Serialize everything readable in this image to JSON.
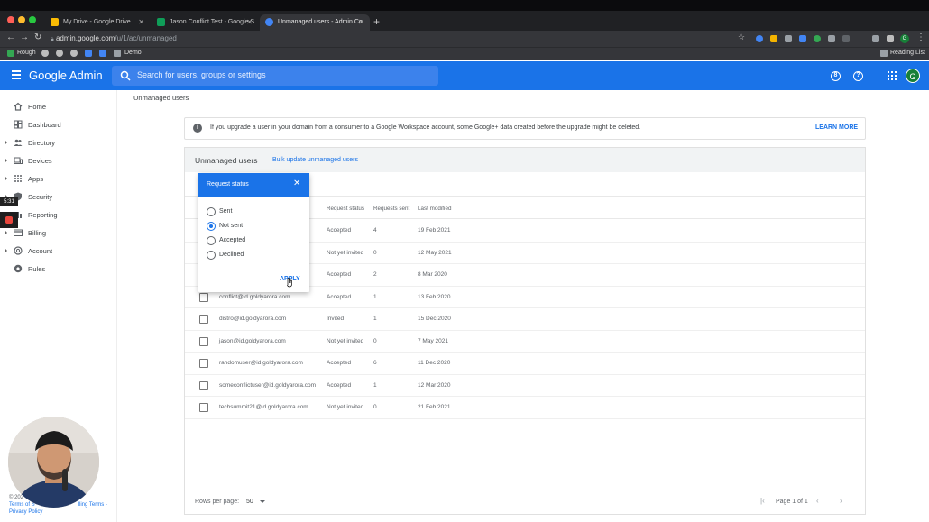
{
  "browser": {
    "tabs": [
      {
        "title": "My Drive - Google Drive",
        "favicon_color": "#fbbc04"
      },
      {
        "title": "Jason Conflict Test - Google S",
        "favicon_color": "#0f9d58"
      },
      {
        "title": "Unmanaged users - Admin Co",
        "favicon_color": "#4285f4",
        "active": true
      }
    ],
    "url_host": "admin.google.com",
    "url_path": "/u/1/ac/unmanaged",
    "bookmarks": [
      "Rough",
      "Demo"
    ],
    "reading_list": "Reading List",
    "profile_initial": "G"
  },
  "admin": {
    "logo": "Google Admin",
    "search_placeholder": "Search for users, groups or settings",
    "help_icon_char": "?",
    "support_icon_char": "8",
    "avatar_initial": "G",
    "accent": "#1a73e8"
  },
  "sidebar": {
    "items": [
      {
        "label": "Home",
        "icon": "home-icon",
        "expandable": false
      },
      {
        "label": "Dashboard",
        "icon": "dashboard-icon",
        "expandable": false
      },
      {
        "label": "Directory",
        "icon": "directory-icon",
        "expandable": true
      },
      {
        "label": "Devices",
        "icon": "devices-icon",
        "expandable": true
      },
      {
        "label": "Apps",
        "icon": "apps-icon",
        "expandable": true
      },
      {
        "label": "Security",
        "icon": "security-icon",
        "expandable": true
      },
      {
        "label": "Reporting",
        "icon": "reporting-icon",
        "expandable": true
      },
      {
        "label": "Billing",
        "icon": "billing-icon",
        "expandable": true
      },
      {
        "label": "Account",
        "icon": "account-icon",
        "expandable": true
      },
      {
        "label": "Rules",
        "icon": "rules-icon",
        "expandable": false
      }
    ],
    "footer_copyright": "© 202",
    "footer_terms_left": "Terms of S",
    "footer_terms_right": "lling Terms -",
    "footer_privacy": "Privacy Policy"
  },
  "overlay": {
    "timer": "5:31"
  },
  "main": {
    "breadcrumb": "Unmanaged users",
    "info_text": "If you upgrade a user in your domain from a consumer to a Google Workspace account, some Google+ data created before the upgrade might be deleted.",
    "learn_more": "LEARN MORE",
    "card_title": "Unmanaged users",
    "bulk_link": "Bulk update unmanaged users",
    "columns": {
      "status": "Request status",
      "sent": "Requests sent",
      "modified": "Last modified"
    },
    "rows": [
      {
        "email": "",
        "status": "Accepted",
        "sent": "4",
        "modified": "19 Feb 2021"
      },
      {
        "email": "",
        "status": "Not yet invited",
        "sent": "0",
        "modified": "12 May 2021"
      },
      {
        "email": "",
        "status": "Accepted",
        "sent": "2",
        "modified": "8 Mar 2020"
      },
      {
        "email": "conflict@id.goldyarora.com",
        "status": "Accepted",
        "sent": "1",
        "modified": "13 Feb 2020"
      },
      {
        "email": "distro@id.goldyarora.com",
        "status": "Invited",
        "sent": "1",
        "modified": "15 Dec 2020"
      },
      {
        "email": "jason@id.goldyarora.com",
        "status": "Not yet invited",
        "sent": "0",
        "modified": "7 May 2021"
      },
      {
        "email": "randomuser@id.goldyarora.com",
        "status": "Accepted",
        "sent": "6",
        "modified": "11 Dec 2020"
      },
      {
        "email": "someconflictuser@id.goldyarora.com",
        "status": "Accepted",
        "sent": "1",
        "modified": "12 Mar 2020"
      },
      {
        "email": "techsummit21@id.goldyarora.com",
        "status": "Not yet invited",
        "sent": "0",
        "modified": "21 Feb 2021"
      }
    ],
    "rows_per_page_label": "Rows per page:",
    "rows_per_page": "50",
    "page_label": "Page 1 of 1"
  },
  "dialog": {
    "title": "Request status",
    "options": [
      {
        "label": "Sent",
        "selected": false
      },
      {
        "label": "Not sent",
        "selected": true
      },
      {
        "label": "Accepted",
        "selected": false
      },
      {
        "label": "Declined",
        "selected": false
      }
    ],
    "apply": "APPLY"
  }
}
